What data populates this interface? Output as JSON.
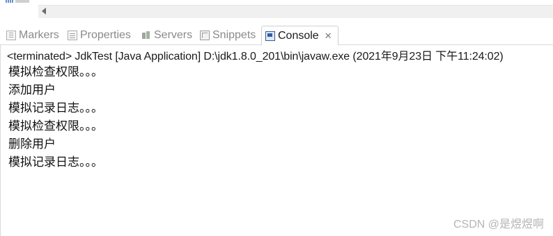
{
  "tabs": [
    {
      "label": "Markers",
      "icon": "markers-icon",
      "active": false
    },
    {
      "label": "Properties",
      "icon": "properties-icon",
      "active": false
    },
    {
      "label": "Servers",
      "icon": "servers-icon",
      "active": false
    },
    {
      "label": "Snippets",
      "icon": "snippets-icon",
      "active": false
    },
    {
      "label": "Console",
      "icon": "console-icon",
      "active": true
    }
  ],
  "tab_close_glyph": "✕",
  "console": {
    "status": "<terminated> JdkTest [Java Application] D:\\jdk1.8.0_201\\bin\\javaw.exe (2021年9月23日 下午11:24:02)",
    "lines": [
      "模拟检查权限。。。",
      "添加用户",
      "模拟记录日志。。。",
      "模拟检查权限。。。",
      "删除用户",
      "模拟记录日志。。。"
    ]
  },
  "watermark": "CSDN @是煜煜啊",
  "colors": {
    "accent": "#2d5da8",
    "inactive_tab_text": "#8a8a8a",
    "border": "#d9d9d9"
  }
}
